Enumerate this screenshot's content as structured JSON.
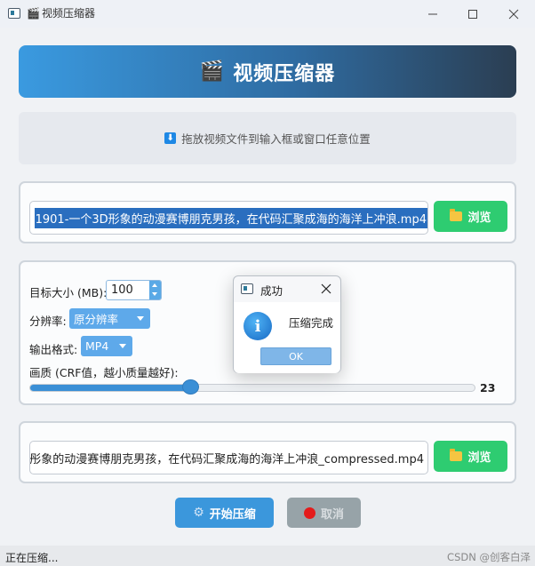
{
  "window": {
    "title": "视频压缩器",
    "title_icon": "clapperboard-icon",
    "controls": [
      "minimize-icon",
      "maximize-icon",
      "close-icon"
    ]
  },
  "header": {
    "icon": "🎬",
    "title": "视频压缩器"
  },
  "dropzone": {
    "icon": "⬇",
    "text": "拖放视频文件到输入框或窗口任意位置"
  },
  "input": {
    "path": "1901-一个3D形象的动漫赛博朋克男孩，在代码汇聚成海的海洋上冲浪.mp4",
    "browse_label": "浏览"
  },
  "settings": {
    "target_size_label": "目标大小 (MB):",
    "target_size_value": "100",
    "resolution_label": "分辨率:",
    "resolution_value": "原分辨率",
    "format_label": "输出格式:",
    "format_value": "MP4",
    "quality_label": "画质 (CRF值，越小质量越好):",
    "quality_value": "23",
    "quality_fraction": 0.36
  },
  "output": {
    "path": "彤象的动漫赛博朋克男孩，在代码汇聚成海的海洋上冲浪_compressed.mp4",
    "browse_label": "浏览"
  },
  "actions": {
    "start_label": "开始压缩",
    "cancel_label": "取消"
  },
  "status": {
    "text": "正在压缩...",
    "watermark": "CSDN @创客白泽"
  },
  "dialog": {
    "title": "成功",
    "message": "压缩完成",
    "ok_label": "OK",
    "icon": "info-icon"
  },
  "colors": {
    "accent": "#3b97dc",
    "browse_green": "#2ecc71",
    "header_start": "#3a9ae0",
    "header_end": "#2b3e52",
    "cancel_disabled": "#97a3a8"
  }
}
